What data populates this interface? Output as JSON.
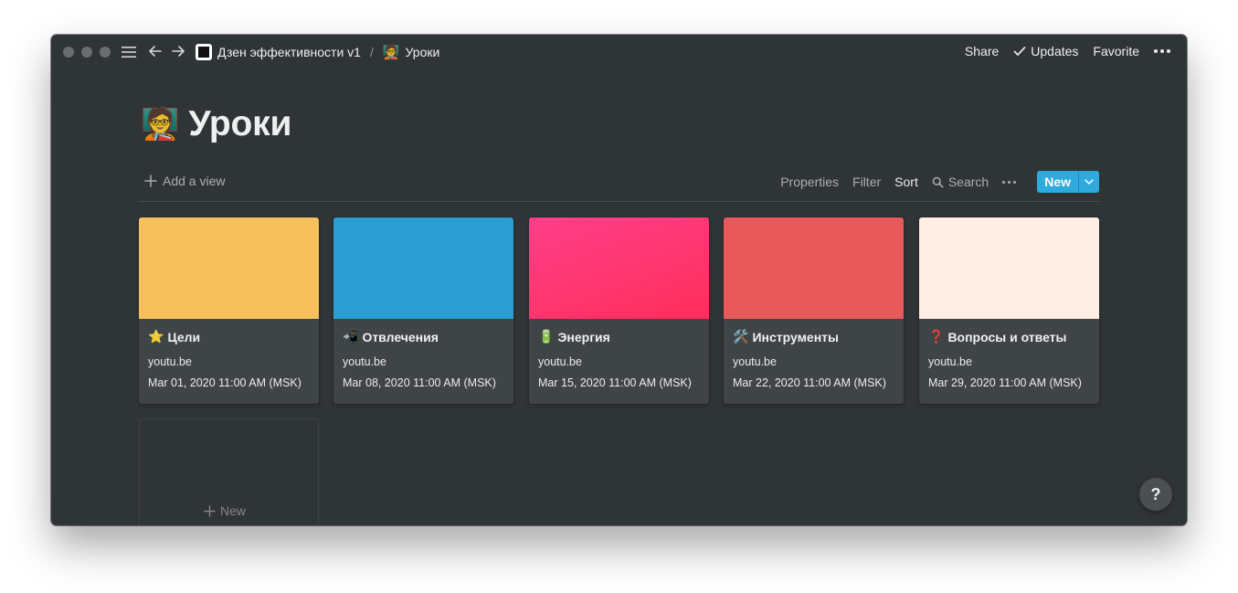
{
  "topbar": {
    "breadcrumb": [
      {
        "icon": "workspace-icon",
        "label": "Дзен эффективности v1"
      },
      {
        "icon": "teacher-emoji",
        "emoji": "🧑‍🏫",
        "label": "Уроки"
      }
    ],
    "separator": "/",
    "share": "Share",
    "updates": "Updates",
    "favorite": "Favorite"
  },
  "page": {
    "emoji": "🧑‍🏫",
    "title": "Уроки"
  },
  "toolbar": {
    "add_view": "Add a view",
    "properties": "Properties",
    "filter": "Filter",
    "sort": "Sort",
    "search": "Search",
    "new": "New"
  },
  "cards": [
    {
      "icon": "⭐",
      "title": "Цели",
      "link": "youtu.be",
      "date": "Mar 01, 2020 11:00 AM (MSK)",
      "cover": "#f6c05c"
    },
    {
      "icon": "📲",
      "title": "Отвлечения",
      "link": "youtu.be",
      "date": "Mar 08, 2020 11:00 AM (MSK)",
      "cover": "#2a9dd1"
    },
    {
      "icon": "🔋",
      "title": "Энергия",
      "link": "youtu.be",
      "date": "Mar 15, 2020 11:00 AM (MSK)",
      "cover": "linear-gradient(160deg,#ff3f8a 0%,#ff2e5a 100%)"
    },
    {
      "icon": "🛠️",
      "title": "Инструменты",
      "link": "youtu.be",
      "date": "Mar 22, 2020 11:00 AM (MSK)",
      "cover": "#e8595c"
    },
    {
      "icon": "❓",
      "title": "Вопросы и ответы",
      "link": "youtu.be",
      "date": "Mar 29, 2020 11:00 AM (MSK)",
      "cover": "#ffeee3"
    }
  ],
  "new_card": "New",
  "help": "?"
}
